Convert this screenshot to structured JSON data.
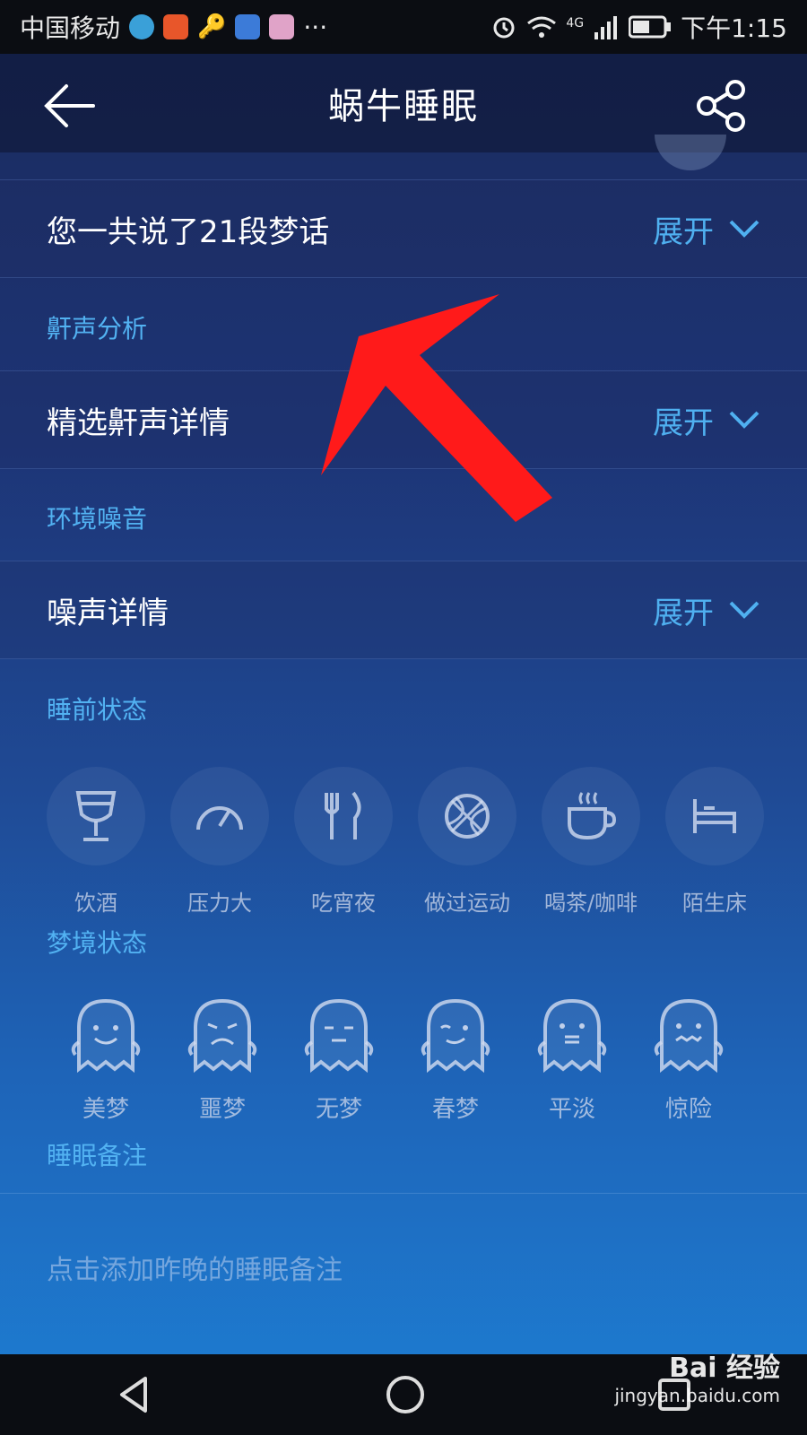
{
  "status": {
    "carrier": "中国移动",
    "more": "···",
    "network": "4G",
    "time": "下午1:15"
  },
  "header": {
    "title": "蜗牛睡眠"
  },
  "rows": {
    "dream_talk": {
      "label": "您一共说了21段梦话",
      "action": "展开"
    },
    "snore_detail": {
      "label": "精选鼾声详情",
      "action": "展开"
    },
    "noise_detail": {
      "label": "噪声详情",
      "action": "展开"
    }
  },
  "sections": {
    "snore": "鼾声分析",
    "noise": "环境噪音",
    "pre_sleep": "睡前状态",
    "dream": "梦境状态",
    "note": "睡眠备注"
  },
  "pre_sleep_items": [
    {
      "label": "饮酒",
      "icon": "wine-glass-icon"
    },
    {
      "label": "压力大",
      "icon": "gauge-icon"
    },
    {
      "label": "吃宵夜",
      "icon": "fork-knife-icon"
    },
    {
      "label": "做过运动",
      "icon": "basketball-icon"
    },
    {
      "label": "喝茶/咖啡",
      "icon": "coffee-cup-icon"
    },
    {
      "label": "陌生床",
      "icon": "bed-icon"
    }
  ],
  "dream_items": [
    {
      "label": "美梦",
      "icon": "ghost-happy-icon"
    },
    {
      "label": "噩梦",
      "icon": "ghost-sad-icon"
    },
    {
      "label": "无梦",
      "icon": "ghost-neutral-icon"
    },
    {
      "label": "春梦",
      "icon": "ghost-wink-icon"
    },
    {
      "label": "平淡",
      "icon": "ghost-flat-icon"
    },
    {
      "label": "惊险",
      "icon": "ghost-scared-icon"
    }
  ],
  "note": {
    "placeholder": "点击添加昨晚的睡眠备注"
  },
  "watermark": {
    "brand": "Bai 经验",
    "url": "jingyan.baidu.com"
  },
  "colors": {
    "accent": "#4fb0f0",
    "arrow": "#ff1a1a"
  }
}
